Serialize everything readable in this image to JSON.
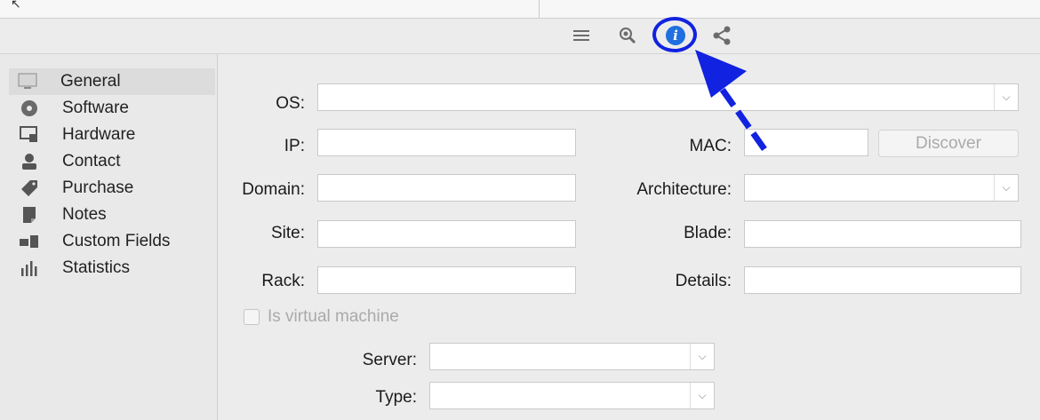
{
  "toolbar": {
    "icons": [
      "list-icon",
      "zoom-icon",
      "info-icon",
      "share-icon"
    ],
    "info_glyph": "i"
  },
  "sidebar": {
    "items": [
      {
        "label": "General",
        "icon": "monitor-icon",
        "selected": true
      },
      {
        "label": "Software",
        "icon": "disc-icon"
      },
      {
        "label": "Hardware",
        "icon": "hardware-icon"
      },
      {
        "label": "Contact",
        "icon": "contact-icon"
      },
      {
        "label": "Purchase",
        "icon": "tag-icon"
      },
      {
        "label": "Notes",
        "icon": "notes-icon"
      },
      {
        "label": "Custom Fields",
        "icon": "custom-fields-icon"
      },
      {
        "label": "Statistics",
        "icon": "statistics-icon"
      }
    ]
  },
  "form": {
    "os_label": "OS:",
    "ip_label": "IP:",
    "mac_label": "MAC:",
    "discover_label": "Discover",
    "domain_label": "Domain:",
    "architecture_label": "Architecture:",
    "site_label": "Site:",
    "blade_label": "Blade:",
    "rack_label": "Rack:",
    "details_label": "Details:",
    "virtual_machine_label": "Is virtual machine",
    "server_label": "Server:",
    "type_label": "Type:",
    "os_value": "",
    "ip_value": "",
    "mac_value": "",
    "domain_value": "",
    "architecture_value": "",
    "site_value": "",
    "blade_value": "",
    "rack_value": "",
    "details_value": "",
    "server_value": "",
    "type_value": "",
    "virtual_machine_checked": false,
    "discover_enabled": false
  },
  "annotation": {
    "highlight_color": "#1122e0",
    "target": "info-icon"
  },
  "colors": {
    "info_blue": "#1f6fe0",
    "arrow_blue": "#1122e0"
  }
}
